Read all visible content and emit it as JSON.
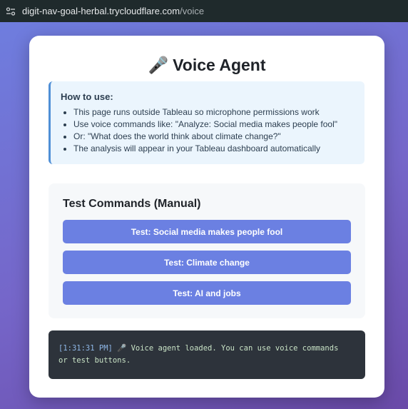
{
  "browser": {
    "url_host": "digit-nav-goal-herbal.trycloudflare.com",
    "url_path": "/voice",
    "site_icon": "page-settings-icon"
  },
  "page": {
    "title_icon": "🎤",
    "title": "Voice Agent"
  },
  "how_to": {
    "heading": "How to use:",
    "items": [
      "This page runs outside Tableau so microphone permissions work",
      "Use voice commands like: \"Analyze: Social media makes people fool\"",
      "Or: \"What does the world think about climate change?\"",
      "The analysis will appear in your Tableau dashboard automatically"
    ]
  },
  "test_commands": {
    "heading": "Test Commands (Manual)",
    "buttons": [
      "Test: Social media makes people fool",
      "Test: Climate change",
      "Test: AI and jobs"
    ]
  },
  "log": {
    "timestamp": "[1:31:31 PM]",
    "icon": "🎤",
    "message": "Voice agent loaded. You can use voice commands",
    "message_cont": "or test buttons."
  },
  "colors": {
    "accent": "#6b80e2",
    "info_border": "#4f8fd6",
    "log_bg": "#2d333b"
  }
}
